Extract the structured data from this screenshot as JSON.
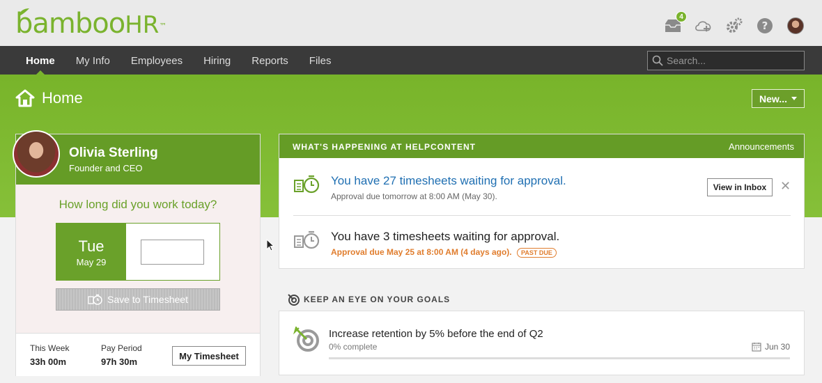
{
  "brand": {
    "logo_main": "bamboo",
    "logo_hr": "HR",
    "logo_tm": "™",
    "accent": "#7ab32e"
  },
  "top_icons": {
    "inbox_badge": "4",
    "icons": [
      "inbox-icon",
      "cloud-upload-icon",
      "gear-icon",
      "help-icon",
      "avatar"
    ]
  },
  "nav": {
    "items": [
      {
        "label": "Home"
      },
      {
        "label": "My Info"
      },
      {
        "label": "Employees"
      },
      {
        "label": "Hiring"
      },
      {
        "label": "Reports"
      },
      {
        "label": "Files"
      }
    ],
    "active": "Home",
    "search_placeholder": "Search..."
  },
  "page": {
    "title": "Home",
    "new_button": "New..."
  },
  "profile": {
    "name": "Olivia Sterling",
    "role": "Founder and CEO",
    "question": "How long did you work today?",
    "day_name": "Tue",
    "day_date": "May 29",
    "hours_value": "",
    "save_label": "Save to Timesheet",
    "this_week_label": "This Week",
    "this_week_value": "33h 00m",
    "pay_period_label": "Pay Period",
    "pay_period_value": "97h 30m",
    "my_timesheet_label": "My Timesheet"
  },
  "happening": {
    "title": "WHAT'S HAPPENING AT HELPCONTENT",
    "link": "Announcements",
    "notifications": [
      {
        "title": "You have 27 timesheets waiting for approval.",
        "sub": "Approval due tomorrow at 8:00 AM (May 30).",
        "button": "View in Inbox",
        "color": "#1f6fb2"
      },
      {
        "title": "You have 3 timesheets waiting for approval.",
        "sub": "Approval due May 25 at 8:00 AM (4 days ago).",
        "badge": "PAST DUE",
        "color": "#e07d2e"
      }
    ]
  },
  "goals": {
    "heading": "KEEP AN EYE ON YOUR GOALS",
    "items": [
      {
        "title": "Increase retention by 5% before the end of Q2",
        "progress_label": "0% complete",
        "progress": 0,
        "due": "Jun 30"
      }
    ]
  }
}
